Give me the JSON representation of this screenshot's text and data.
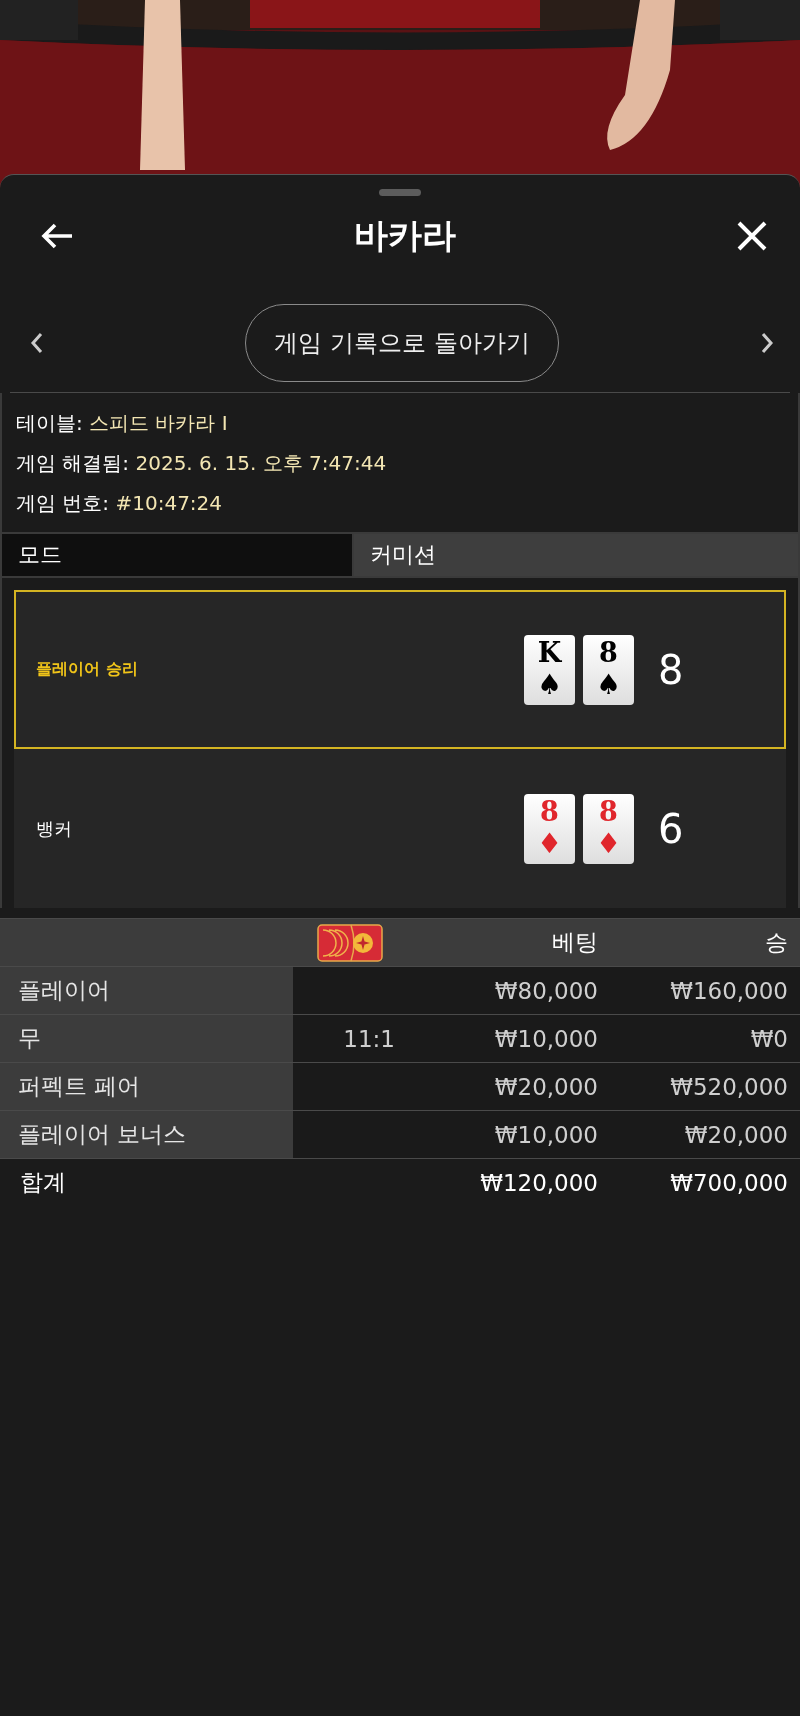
{
  "header": {
    "title": "바카라"
  },
  "nav": {
    "back_to_history": "게임 기록으로 돌아가기"
  },
  "info": [
    {
      "label": "테이블:",
      "value": "스피드 바카라 I"
    },
    {
      "label": "게임 해결됨:",
      "value": "2025. 6. 15. 오후 7:47:44"
    },
    {
      "label": "게임 번호:",
      "value": "#10:47:24"
    }
  ],
  "mode_row": {
    "label": "모드",
    "value": "커미션"
  },
  "hands": [
    {
      "label": "플레이어 승리",
      "selected": true,
      "total": "8",
      "cards": [
        {
          "rank": "K",
          "suit": "♠",
          "color": "#000000"
        },
        {
          "rank": "8",
          "suit": "♠",
          "color": "#000000"
        }
      ]
    },
    {
      "label": "뱅커",
      "selected": false,
      "total": "6",
      "cards": [
        {
          "rank": "8",
          "suit": "♦",
          "color": "#e0262c"
        },
        {
          "rank": "8",
          "suit": "♦",
          "color": "#e0262c"
        }
      ]
    }
  ],
  "bets_table": {
    "columns": [
      "베팅",
      "승"
    ],
    "rows": [
      {
        "name": "플레이어",
        "odds": "",
        "bet": "₩80,000",
        "win": "₩160,000"
      },
      {
        "name": "무",
        "odds": "11:1",
        "bet": "₩10,000",
        "win": "₩0"
      },
      {
        "name": "퍼펙트 페어",
        "odds": "",
        "bet": "₩20,000",
        "win": "₩520,000"
      },
      {
        "name": "플레이어 보너스",
        "odds": "",
        "bet": "₩10,000",
        "win": "₩20,000"
      }
    ],
    "total": {
      "label": "합계",
      "bet": "₩120,000",
      "win": "₩700,000"
    }
  }
}
